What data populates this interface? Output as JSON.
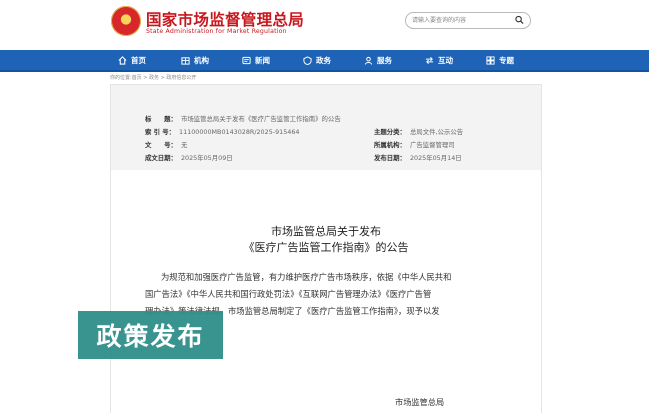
{
  "header": {
    "site_title": "国家市场监督管理总局",
    "site_subtitle": "State Administration for Market Regulation",
    "search_placeholder": "请输入要查询的内容"
  },
  "nav": {
    "items": [
      {
        "label": "首页",
        "icon": "home-icon"
      },
      {
        "label": "机构",
        "icon": "org-icon"
      },
      {
        "label": "新闻",
        "icon": "news-icon"
      },
      {
        "label": "政务",
        "icon": "gov-affairs-icon"
      },
      {
        "label": "服务",
        "icon": "service-icon"
      },
      {
        "label": "互动",
        "icon": "interaction-icon"
      },
      {
        "label": "专题",
        "icon": "topic-icon"
      }
    ]
  },
  "breadcrumb": "你的位置:首页 > 政务 > 政府信息公开",
  "meta": {
    "title_label": "标　　题：",
    "title_value": "市场监管总局关于发布《医疗广告监管工作指南》的公告",
    "index_label": "索 引 号：",
    "index_value": "11100000MB0143028R/2025-915464",
    "topic_label": "主题分类：",
    "topic_value": "总局文件,公示公告",
    "doc_label": "文　　号：",
    "doc_value": "无",
    "org_label": "所属机构：",
    "org_value": "广告监督管理司",
    "created_label": "成文日期：",
    "created_value": "2025年05月09日",
    "published_label": "发布日期：",
    "published_value": "2025年05月14日"
  },
  "document": {
    "title_line1": "市场监管总局关于发布",
    "title_line2": "《医疗广告监管工作指南》的公告",
    "para_line1": "为规范和加强医疗广告监管，有力维护医疗广告市场秩序，依据《中华人民共和",
    "para_line2": "国广告法》《中华人民共和国行政处罚法》《互联网广告管理办法》《医疗广告管",
    "para_line3": "理办法》等法律法规，市场监管总局制定了《医疗广告监管工作指南》，现予以发",
    "signature": "市场监管总局"
  },
  "badge": {
    "text": "政策发布"
  },
  "colors": {
    "brand_red": "#c8161d",
    "nav_blue": "#1e63b6",
    "badge_teal": "#2f8e8a"
  }
}
